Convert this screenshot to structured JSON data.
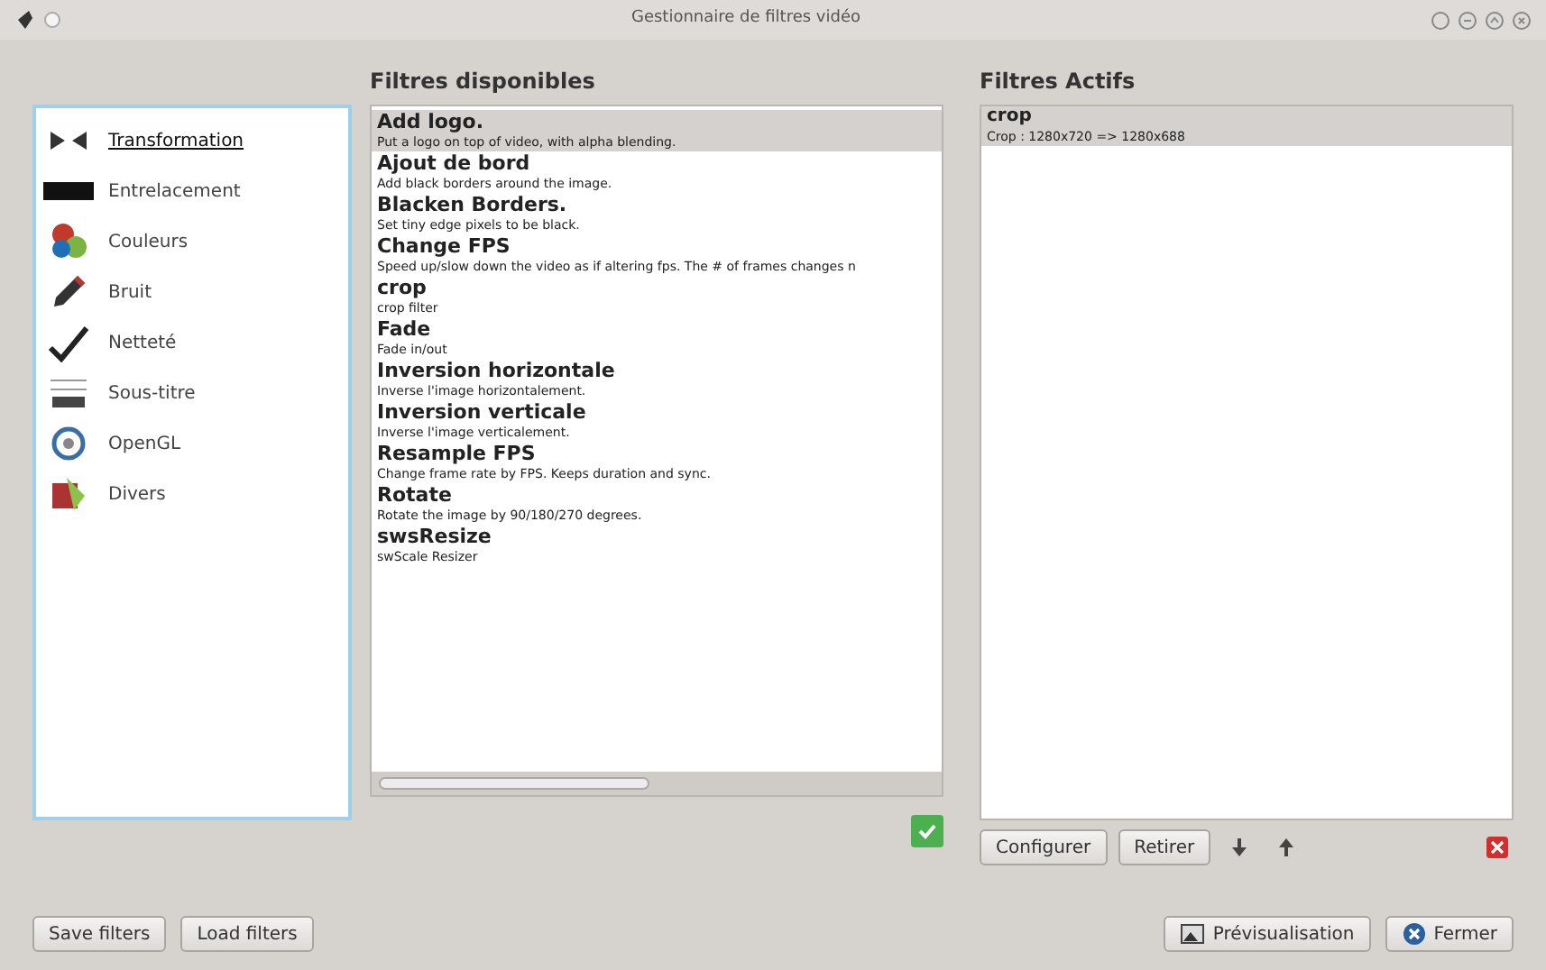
{
  "window": {
    "title": "Gestionnaire de filtres vidéo"
  },
  "categories": [
    {
      "label": "Transformation",
      "selected": true
    },
    {
      "label": "Entrelacement",
      "selected": false
    },
    {
      "label": "Couleurs",
      "selected": false
    },
    {
      "label": "Bruit",
      "selected": false
    },
    {
      "label": "Netteté",
      "selected": false
    },
    {
      "label": "Sous-titre",
      "selected": false
    },
    {
      "label": "OpenGL",
      "selected": false
    },
    {
      "label": "Divers",
      "selected": false
    }
  ],
  "available": {
    "heading": "Filtres disponibles",
    "items": [
      {
        "name": "Add logo.",
        "description": "Put a logo on top of video, with alpha blending.",
        "selected": true
      },
      {
        "name": "Ajout de bord",
        "description": "Add black borders around the image.",
        "selected": false
      },
      {
        "name": "Blacken Borders.",
        "description": "Set tiny edge pixels to be black.",
        "selected": false
      },
      {
        "name": "Change FPS",
        "description": "Speed up/slow down the video as if altering fps. The # of frames changes n",
        "selected": false
      },
      {
        "name": "crop",
        "description": "crop filter",
        "selected": false
      },
      {
        "name": "Fade",
        "description": "Fade in/out",
        "selected": false
      },
      {
        "name": "Inversion horizontale",
        "description": "Inverse l'image horizontalement.",
        "selected": false
      },
      {
        "name": "Inversion verticale",
        "description": "Inverse l'image verticalement.",
        "selected": false
      },
      {
        "name": "Resample FPS",
        "description": "Change frame rate by FPS. Keeps duration and sync.",
        "selected": false
      },
      {
        "name": "Rotate",
        "description": "Rotate the image by 90/180/270 degrees.",
        "selected": false
      },
      {
        "name": "swsResize",
        "description": "swScale Resizer",
        "selected": false
      }
    ]
  },
  "active": {
    "heading": "Filtres Actifs",
    "items": [
      {
        "name": "crop",
        "description": "Crop : 1280x720 => 1280x688",
        "selected": true
      }
    ]
  },
  "active_buttons": [
    "Configurer",
    "Retirer"
  ],
  "bottom_left": [
    "Save filters",
    "Load filters"
  ],
  "bottom_right": [
    "Prévisualisation",
    "Fermer"
  ]
}
